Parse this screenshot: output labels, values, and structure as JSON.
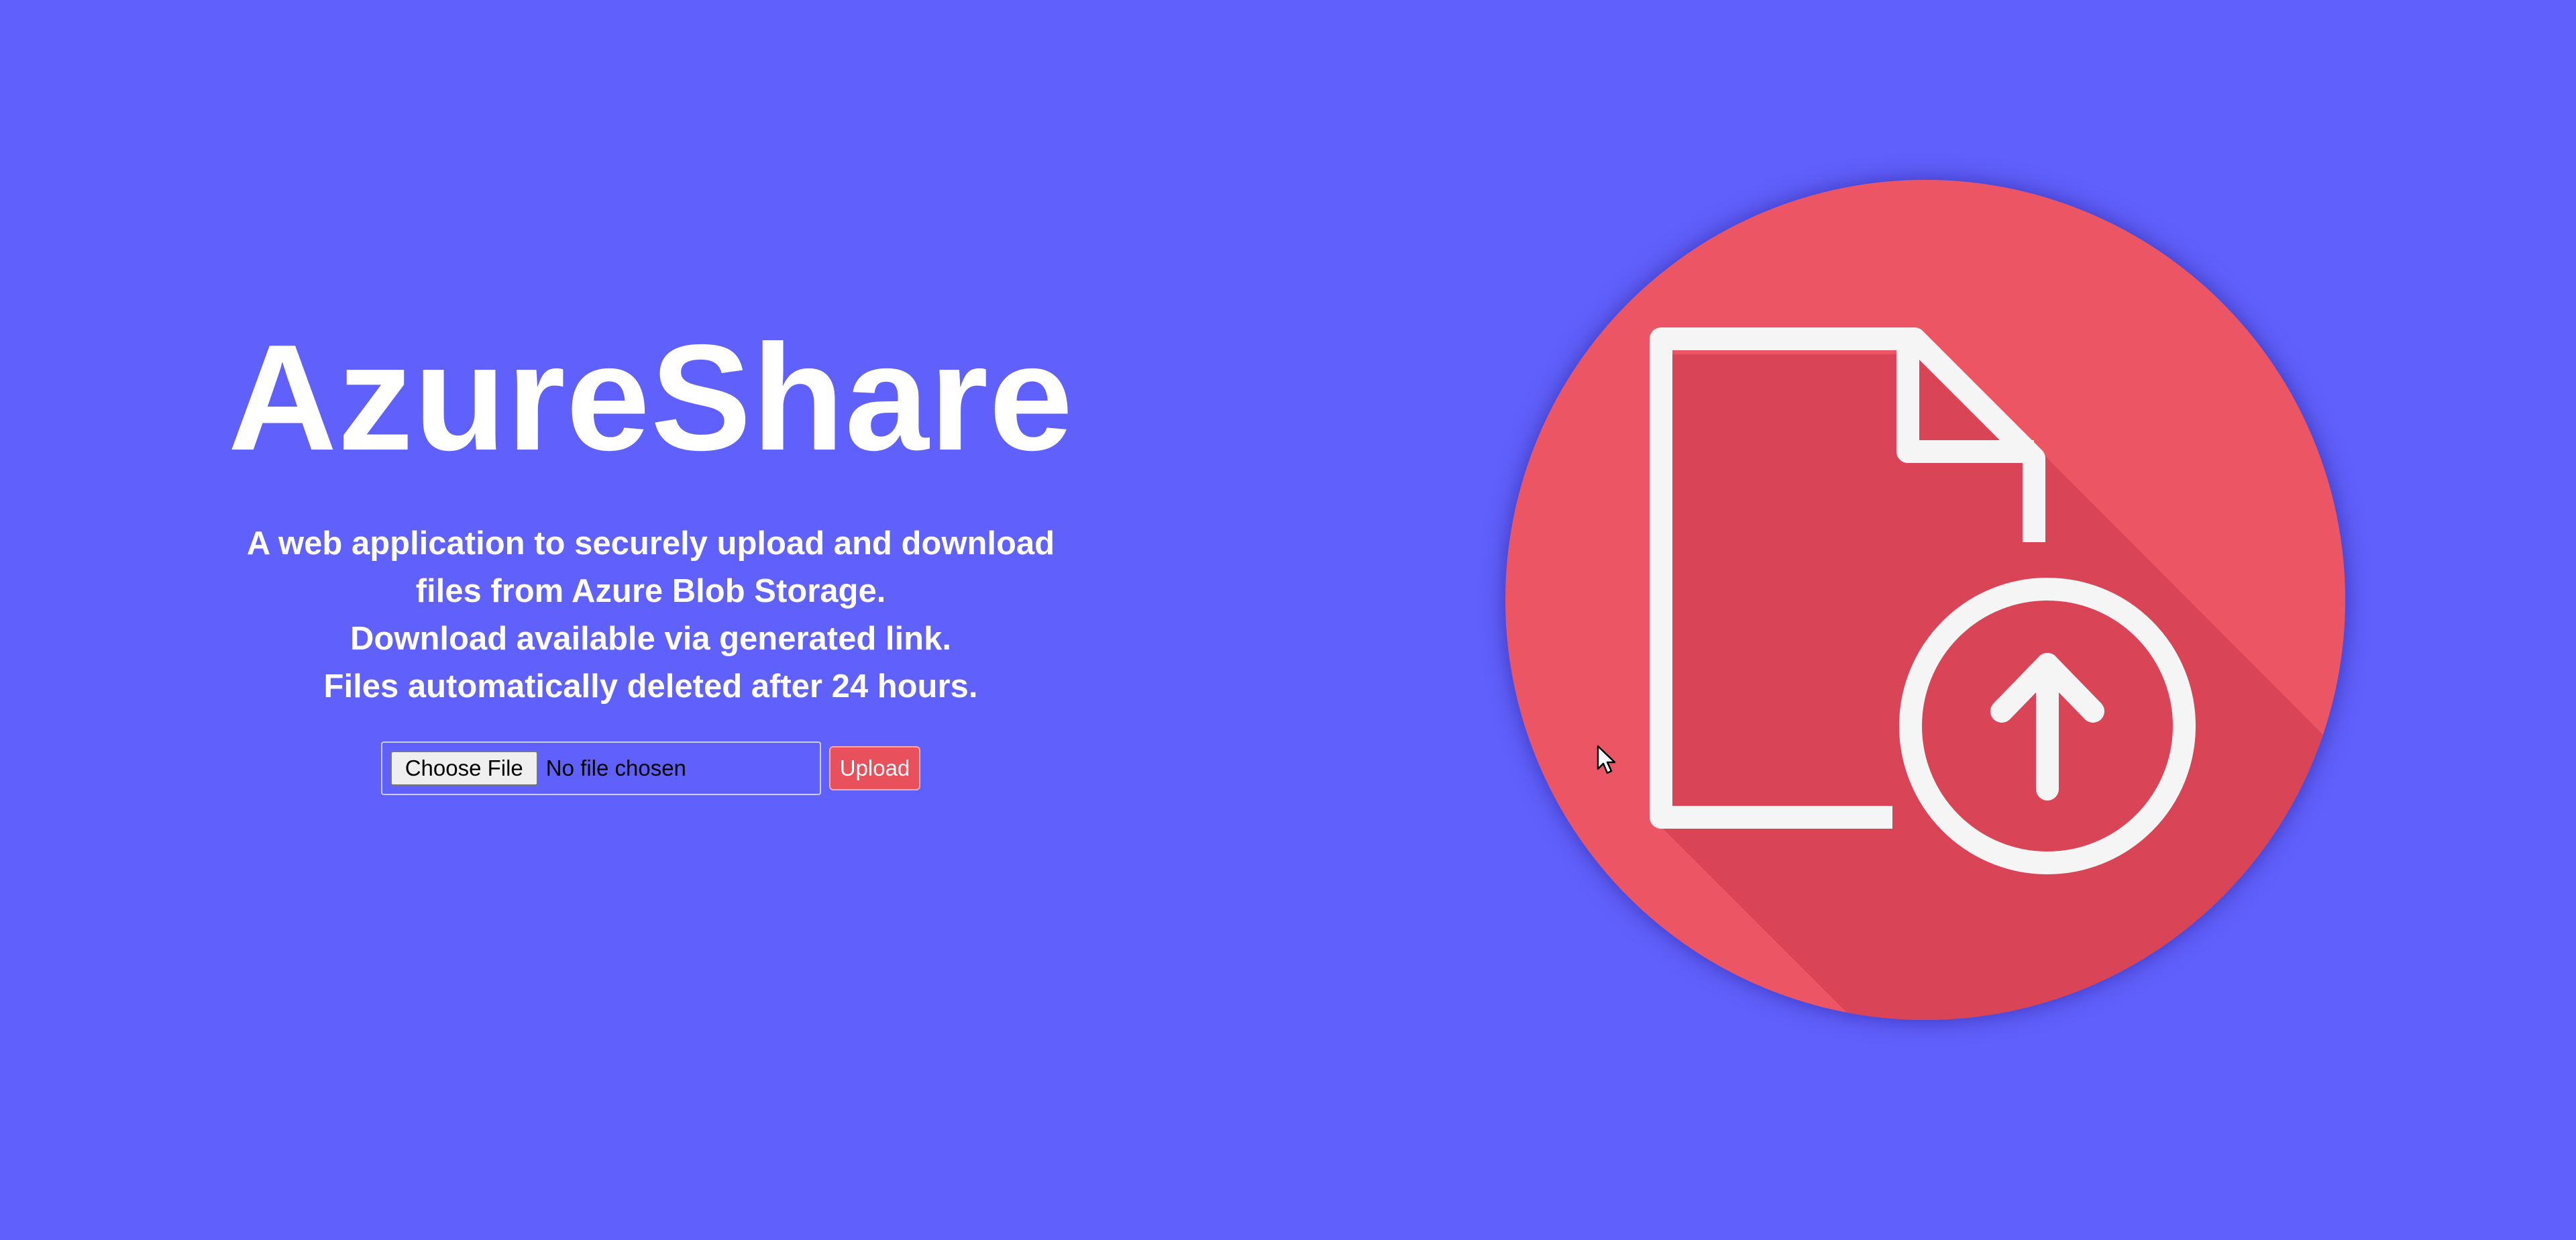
{
  "app": {
    "title": "AzureShare",
    "description_lines": [
      "A web application to securely upload and download",
      "files from Azure Blob Storage.",
      "Download available via generated link.",
      "Files automatically deleted after 24 hours."
    ]
  },
  "upload_form": {
    "choose_file_label": "Choose File",
    "file_status": "No file chosen",
    "upload_label": "Upload"
  },
  "illustration": {
    "icon": "file-upload-icon",
    "circle_color": "#ec5564",
    "shadow_color": "#d94556",
    "line_color": "#f5f5f5"
  },
  "colors": {
    "background": "#6060fc",
    "accent": "#e8505b"
  }
}
